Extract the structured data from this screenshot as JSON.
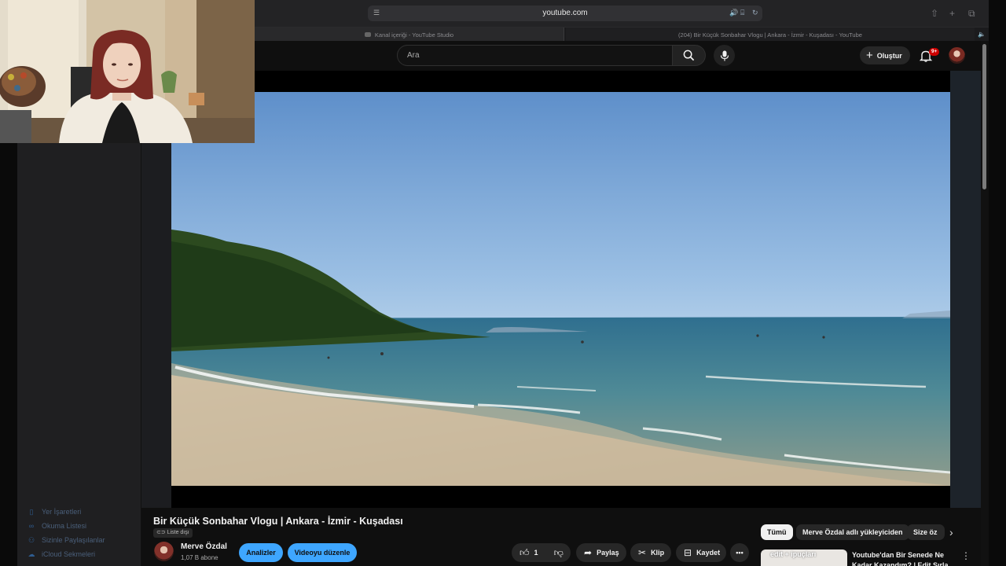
{
  "sidebar": {
    "items": [
      {
        "icon": "bookmark-icon",
        "label": "Yer İşaretleri"
      },
      {
        "icon": "reading-list-icon",
        "label": "Okuma Listesi"
      },
      {
        "icon": "shared-with-you-icon",
        "label": "Sizinle Paylaşılanlar"
      },
      {
        "icon": "icloud-icon",
        "label": "iCloud Sekmeleri"
      }
    ]
  },
  "browser": {
    "url": "youtube.com",
    "tabs": [
      {
        "label": "Kanal içeriği - YouTube Studio"
      },
      {
        "label": "(204) Bir Küçük Sonbahar Vlogu | Ankara - İzmir - Kuşadası - YouTube"
      }
    ]
  },
  "masthead": {
    "search_placeholder": "Ara",
    "create_label": "Oluştur",
    "notifications_badge": "9+"
  },
  "video": {
    "title": "Bir Küçük Sonbahar Vlogu | Ankara - İzmir - Kuşadası",
    "visibility": "Liste dışı",
    "channel_name": "Merve Özdal",
    "subscribers": "1,07 B abone",
    "analytics_label": "Analizler",
    "edit_label": "Videoyu düzenle",
    "like_count": "1",
    "share_label": "Paylaş",
    "clip_label": "Klip",
    "save_label": "Kaydet"
  },
  "chips": [
    "Tümü",
    "Merve Özdal adlı yükleyiciden",
    "Size öz"
  ],
  "recommendation": {
    "thumb_text": "edit + ipuçları",
    "title": "Youtube'dan Bir Senede Ne Kadar Kazandım? | Edit Sırla"
  },
  "colors": {
    "accent_blue": "#3ea6ff",
    "badge_red": "#cc0000",
    "background": "#0f0f0f"
  }
}
